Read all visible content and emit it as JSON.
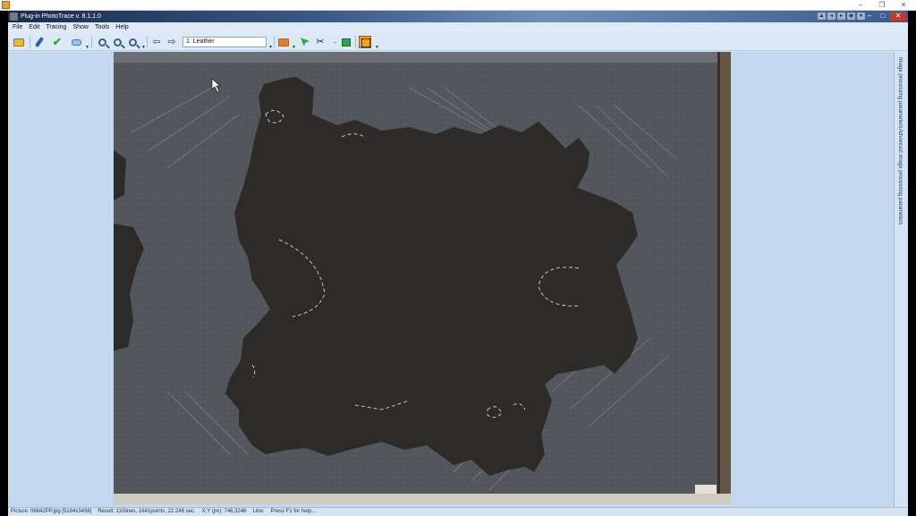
{
  "window": {
    "title": "Plug-in PhotoTrace v. 8.1.1.0"
  },
  "menu": {
    "items": [
      "File",
      "Edit",
      "Tracing",
      "Show",
      "Tools",
      "Help"
    ]
  },
  "toolbar": {
    "layer_value": "1: Leather",
    "icons": [
      "open-folder-icon",
      "pen-icon",
      "check-icon",
      "eraser-icon",
      "zoom-in-icon",
      "zoom-out-icon",
      "zoom-fit-icon",
      "arrow-left-icon",
      "arrow-right-icon",
      "layer-folder-icon",
      "node-select-icon",
      "scissors-icon",
      "flag-icon",
      "selection-rect-icon"
    ],
    "accent_color": "#f4a11b"
  },
  "side_tabs": {
    "tab1": "Image processing parameters",
    "tab2": "Advanced image processing parameters"
  },
  "status": {
    "picture": "Picture: 06842PP.jpg [5184x3456]",
    "result": "Result: 110lines, 1641points, 22.246 sec.",
    "coords": "X,Y (px): 746,3246",
    "line": "Line:",
    "hint": "Press F1 for help..."
  }
}
